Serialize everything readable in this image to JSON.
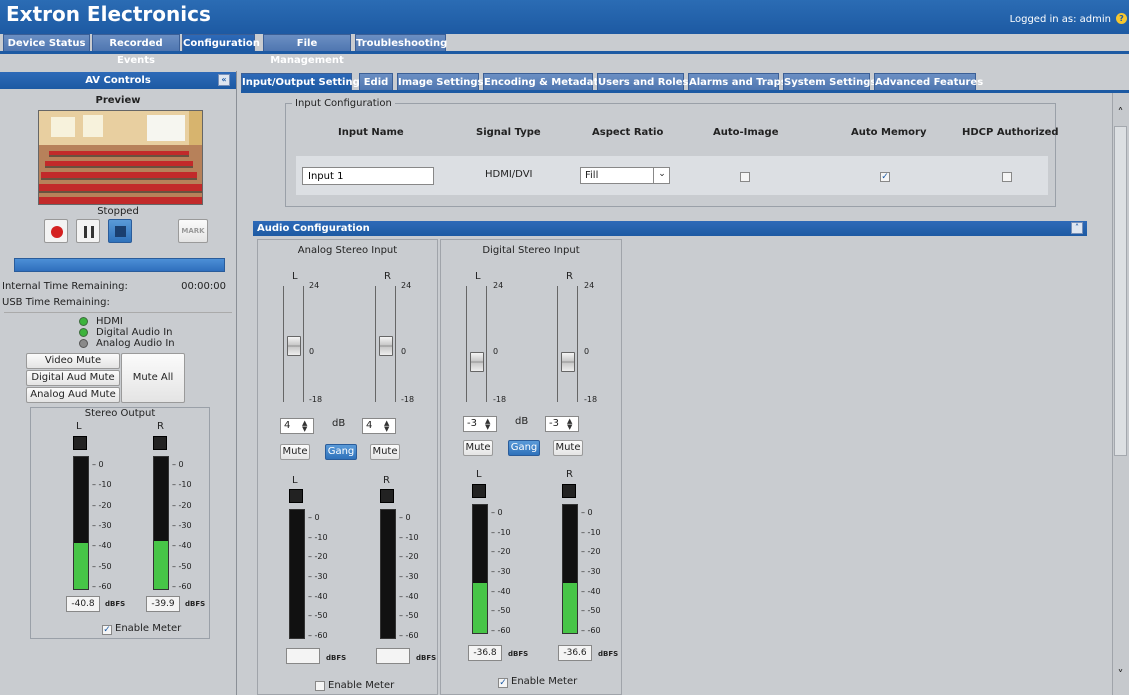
{
  "app": {
    "title": "Extron Electronics",
    "login_status": "Logged in as: admin",
    "help_icon": "help-icon"
  },
  "main_tabs": [
    "Device Status",
    "Recorded Events",
    "Configuration",
    "File Management",
    "Troubleshooting"
  ],
  "main_tab_active": "Configuration",
  "left_panel": {
    "title": "AV Controls",
    "preview_label": "Preview",
    "status": "Stopped",
    "transport": {
      "record": "record-icon",
      "pause": "pause-icon",
      "stop": "stop-icon",
      "mark_label": "MARK"
    },
    "internal_time_label": "Internal Time Remaining:",
    "internal_time_value": "00:00:00",
    "usb_time_label": "USB Time Remaining:",
    "signals": [
      {
        "label": "HDMI",
        "color": "#3cb33c"
      },
      {
        "label": "Digital Audio In",
        "color": "#3cb33c"
      },
      {
        "label": "Analog Audio In",
        "color": "#8a8a8a"
      }
    ],
    "mute_buttons": [
      "Video Mute",
      "Digital Aud Mute",
      "Analog Aud Mute"
    ],
    "mute_all_label": "Mute All",
    "stereo_output": {
      "title": "Stereo Output",
      "left_label": "L",
      "right_label": "R",
      "scale": [
        "0",
        "-10",
        "-20",
        "-30",
        "-40",
        "-50",
        "-60"
      ],
      "left_value": "-40.8",
      "right_value": "-39.9",
      "left_level": 0.345,
      "right_level": 0.36,
      "unit": "dBFS",
      "enable_meter_label": "Enable Meter",
      "enable_meter_checked": true
    }
  },
  "sub_tabs": [
    "Input/Output Settings",
    "Edid",
    "Image Settings",
    "Encoding & Metadata",
    "Users and Roles",
    "Alarms and Traps",
    "System Settings",
    "Advanced Features"
  ],
  "sub_tab_active": "Input/Output Settings",
  "input_config": {
    "legend": "Input Configuration",
    "headers": [
      "Input Name",
      "Signal Type",
      "Aspect Ratio",
      "Auto-Image",
      "Auto Memory",
      "HDCP Authorized"
    ],
    "row": {
      "input_name": "Input 1",
      "signal_type": "HDMI/DVI",
      "aspect_ratio": "Fill",
      "auto_image": false,
      "auto_memory": true,
      "hdcp_authorized": false
    }
  },
  "audio_config": {
    "title": "Audio Configuration",
    "analog": {
      "title": "Analog Stereo Input",
      "fader_labels": [
        "L",
        "R"
      ],
      "fader_top": "24",
      "fader_mid": "0",
      "fader_bottom": "-18",
      "left_db": "4",
      "right_db": "4",
      "db_unit": "dB",
      "mute_label": "Mute",
      "gang_label": "Gang",
      "meter_labels": [
        "L",
        "R"
      ],
      "scale": [
        "0",
        "-10",
        "-20",
        "-30",
        "-40",
        "-50",
        "-60"
      ],
      "left_value": "",
      "right_value": "",
      "left_level": 0,
      "right_level": 0,
      "unit": "dBFS",
      "enable_meter_label": "Enable Meter",
      "enable_meter_checked": false
    },
    "digital": {
      "title": "Digital Stereo Input",
      "fader_labels": [
        "L",
        "R"
      ],
      "fader_top": "24",
      "fader_mid": "0",
      "fader_bottom": "-18",
      "left_db": "-3",
      "right_db": "-3",
      "db_unit": "dB",
      "mute_label": "Mute",
      "gang_label": "Gang",
      "meter_labels": [
        "L",
        "R"
      ],
      "scale": [
        "0",
        "-10",
        "-20",
        "-30",
        "-40",
        "-50",
        "-60"
      ],
      "left_value": "-36.8",
      "right_value": "-36.6",
      "left_level": 0.39,
      "right_level": 0.39,
      "unit": "dBFS",
      "enable_meter_label": "Enable Meter",
      "enable_meter_checked": true
    }
  }
}
